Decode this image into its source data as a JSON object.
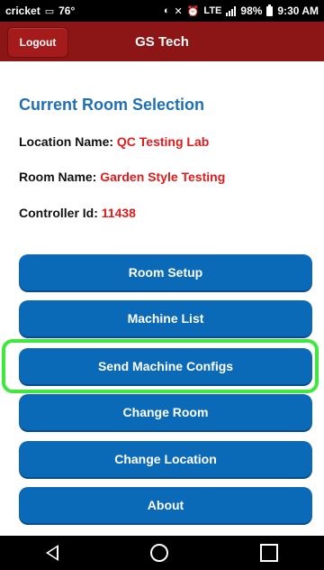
{
  "status_bar": {
    "carrier": "cricket",
    "temperature": "76°",
    "network": "LTE",
    "battery": "98%",
    "time": "9:30 AM"
  },
  "header": {
    "title": "GS Tech",
    "logout_label": "Logout"
  },
  "main": {
    "section_title": "Current Room Selection",
    "location_label": "Location Name:",
    "location_value": "QC Testing Lab",
    "room_label": "Room Name:",
    "room_value": "Garden Style Testing",
    "controller_label": "Controller Id:",
    "controller_value": "11438"
  },
  "menu": {
    "room_setup": "Room Setup",
    "machine_list": "Machine List",
    "send_machine_configs": "Send Machine Configs",
    "change_room": "Change Room",
    "change_location": "Change Location",
    "about": "About"
  },
  "colors": {
    "header_bg": "#8c1515",
    "button_bg": "#0b6ab8",
    "section_title": "#1f6fb5",
    "value_text": "#e01b1b",
    "highlight": "#3ee83e"
  }
}
